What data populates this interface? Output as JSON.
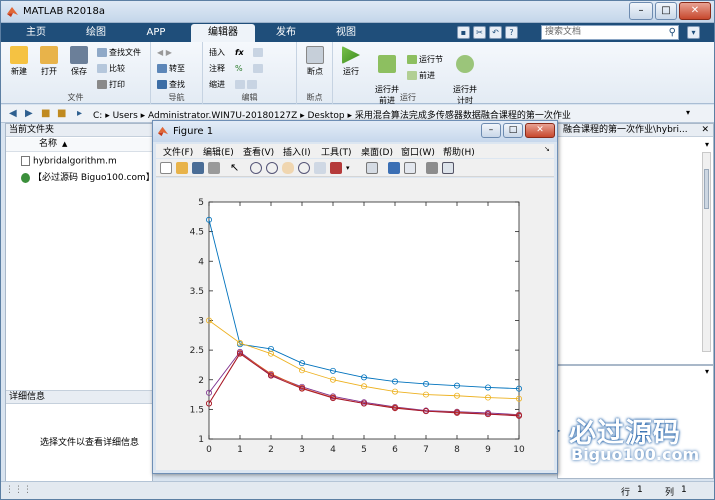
{
  "window": {
    "title": "MATLAB R2018a",
    "minimize": "–",
    "maximize": "□",
    "close": "✕"
  },
  "tabs": [
    {
      "label": "主页"
    },
    {
      "label": "绘图"
    },
    {
      "label": "APP"
    },
    {
      "label": "编辑器",
      "active": true
    },
    {
      "label": "发布"
    },
    {
      "label": "视图"
    }
  ],
  "search": {
    "placeholder": "搜索文档"
  },
  "ribbon": {
    "file": {
      "group_label": "文件",
      "new": "新建",
      "open": "打开",
      "save": "保存",
      "find_files": "查找文件",
      "compare": "比较",
      "print": "打印"
    },
    "navigate": {
      "group_label": "导航",
      "goto": "转至",
      "find": "查找"
    },
    "edit": {
      "group_label": "编辑",
      "insert": "插入",
      "comment": "注释",
      "indent": "缩进"
    },
    "breakpoints": {
      "group_label": "断点",
      "breakpoints": "断点"
    },
    "run": {
      "group_label": "运行",
      "run": "运行",
      "run_advance": "运行并\n前进",
      "run_section": "运行节",
      "advance": "前进",
      "run_time": "运行并\n计时"
    }
  },
  "address": {
    "segments": [
      "C:",
      "Users",
      "Administrator.WIN7U-20180127Z",
      "Desktop",
      "采用混合算法完成多传感器数据融合课程的第一次作业"
    ]
  },
  "current_folder": {
    "title": "当前文件夹",
    "column_name": "名称",
    "files": [
      {
        "name": "hybridalgorithm.m",
        "icon": "m-file-icon"
      },
      {
        "name": "【必过源码 Biguo100.com】必",
        "icon": "link-icon"
      }
    ],
    "details_title": "详细信息",
    "details_hint": "选择文件以查看详细信息"
  },
  "editor_tab": {
    "label": "融合课程的第一次作业\\hybri..."
  },
  "status": {
    "line_label": "行",
    "line_value": "1",
    "col_label": "列",
    "col_value": "1"
  },
  "watermark": {
    "title": "必过源码",
    "url": "Biguo100.com"
  },
  "figure": {
    "title": "Figure 1",
    "menu": [
      "文件(F)",
      "编辑(E)",
      "查看(V)",
      "插入(I)",
      "工具(T)",
      "桌面(D)",
      "窗口(W)",
      "帮助(H)"
    ]
  },
  "chart_data": {
    "type": "line",
    "title": "",
    "xlabel": "",
    "ylabel": "",
    "x": [
      0,
      1,
      2,
      3,
      4,
      5,
      6,
      7,
      8,
      9,
      10
    ],
    "xlim": [
      0,
      10
    ],
    "ylim": [
      1,
      5
    ],
    "xticks": [
      0,
      1,
      2,
      3,
      4,
      5,
      6,
      7,
      8,
      9,
      10
    ],
    "yticks": [
      1,
      1.5,
      2,
      2.5,
      3,
      3.5,
      4,
      4.5,
      5
    ],
    "grid": false,
    "marker": "circle",
    "series": [
      {
        "color": "#0072bd",
        "values": [
          4.7,
          2.6,
          2.52,
          2.28,
          2.15,
          2.04,
          1.97,
          1.93,
          1.9,
          1.87,
          1.85
        ]
      },
      {
        "color": "#edb120",
        "values": [
          3.0,
          2.62,
          2.44,
          2.16,
          2.0,
          1.89,
          1.8,
          1.75,
          1.73,
          1.7,
          1.68
        ]
      },
      {
        "color": "#7e2f8e",
        "values": [
          1.78,
          2.47,
          2.08,
          1.88,
          1.72,
          1.62,
          1.54,
          1.48,
          1.46,
          1.44,
          1.41
        ]
      },
      {
        "color": "#d95319",
        "values": [
          1.6,
          2.45,
          2.1,
          1.86,
          1.7,
          1.6,
          1.53,
          1.47,
          1.45,
          1.42,
          1.4
        ]
      },
      {
        "color": "#a2142f",
        "values": [
          1.6,
          2.44,
          2.07,
          1.85,
          1.69,
          1.6,
          1.52,
          1.47,
          1.44,
          1.42,
          1.39
        ]
      }
    ]
  }
}
